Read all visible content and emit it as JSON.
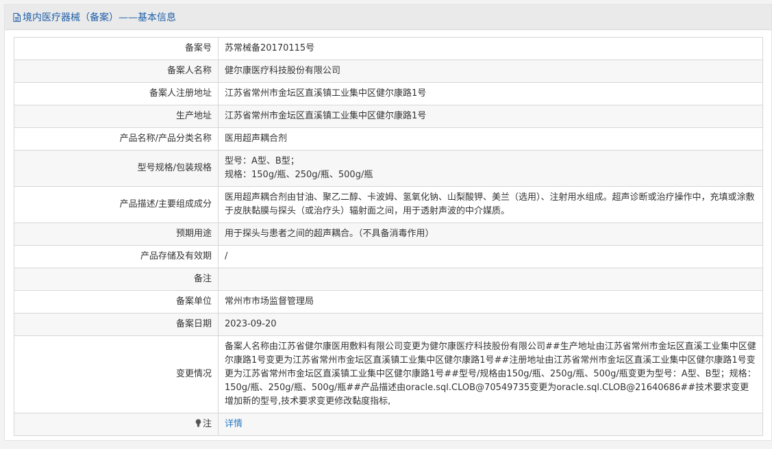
{
  "header": {
    "title": "境内医疗器械（备案）——基本信息",
    "icon": "document-icon",
    "color": "#1d5ea8"
  },
  "rows": [
    {
      "label": "备案号",
      "value": "苏常械备20170115号"
    },
    {
      "label": "备案人名称",
      "value": "健尔康医疗科技股份有限公司"
    },
    {
      "label": "备案人注册地址",
      "value": "江苏省常州市金坛区直溪镇工业集中区健尔康路1号"
    },
    {
      "label": "生产地址",
      "value": "江苏省常州市金坛区直溪镇工业集中区健尔康路1号"
    },
    {
      "label": "产品名称/产品分类名称",
      "value": "医用超声耦合剂"
    },
    {
      "label": "型号规格/包装规格",
      "value": "型号：A型、B型；\n规格：150g/瓶、250g/瓶、500g/瓶"
    },
    {
      "label": "产品描述/主要组成成分",
      "value": "医用超声耦合剂由甘油、聚乙二醇、卡波姆、氢氧化钠、山梨酸钾、美兰（选用）、注射用水组成。超声诊断或治疗操作中，充填或涂敷于皮肤黏膜与探头（或治疗头）辐射面之间，用于透射声波的中介媒质。"
    },
    {
      "label": "预期用途",
      "value": "用于探头与患者之间的超声耦合。（不具备消毒作用）"
    },
    {
      "label": "产品存储及有效期",
      "value": "/"
    },
    {
      "label": "备注",
      "value": ""
    },
    {
      "label": "备案单位",
      "value": "常州市市场监督管理局"
    },
    {
      "label": "备案日期",
      "value": "2023-09-20"
    },
    {
      "label": "变更情况",
      "value": "备案人名称由江苏省健尔康医用敷料有限公司变更为健尔康医疗科技股份有限公司##生产地址由江苏省常州市金坛区直溪工业集中区健尔康路1号变更为江苏省常州市金坛区直溪镇工业集中区健尔康路1号##注册地址由江苏省常州市金坛区直溪工业集中区健尔康路1号变更为江苏省常州市金坛区直溪镇工业集中区健尔康路1号##型号/规格由150g/瓶、250g/瓶、500g/瓶变更为型号：A型、B型；规格：150g/瓶、250g/瓶、500g/瓶##产品描述由oracle.sql.CLOB@70549735变更为oracle.sql.CLOB@21640686##技术要求变更增加新的型号,技术要求变更修改黏度指标,"
    }
  ],
  "note": {
    "label": "注",
    "icon": "lightbulb-icon",
    "link_text": "详情",
    "link_color": "#2a7bc4"
  }
}
